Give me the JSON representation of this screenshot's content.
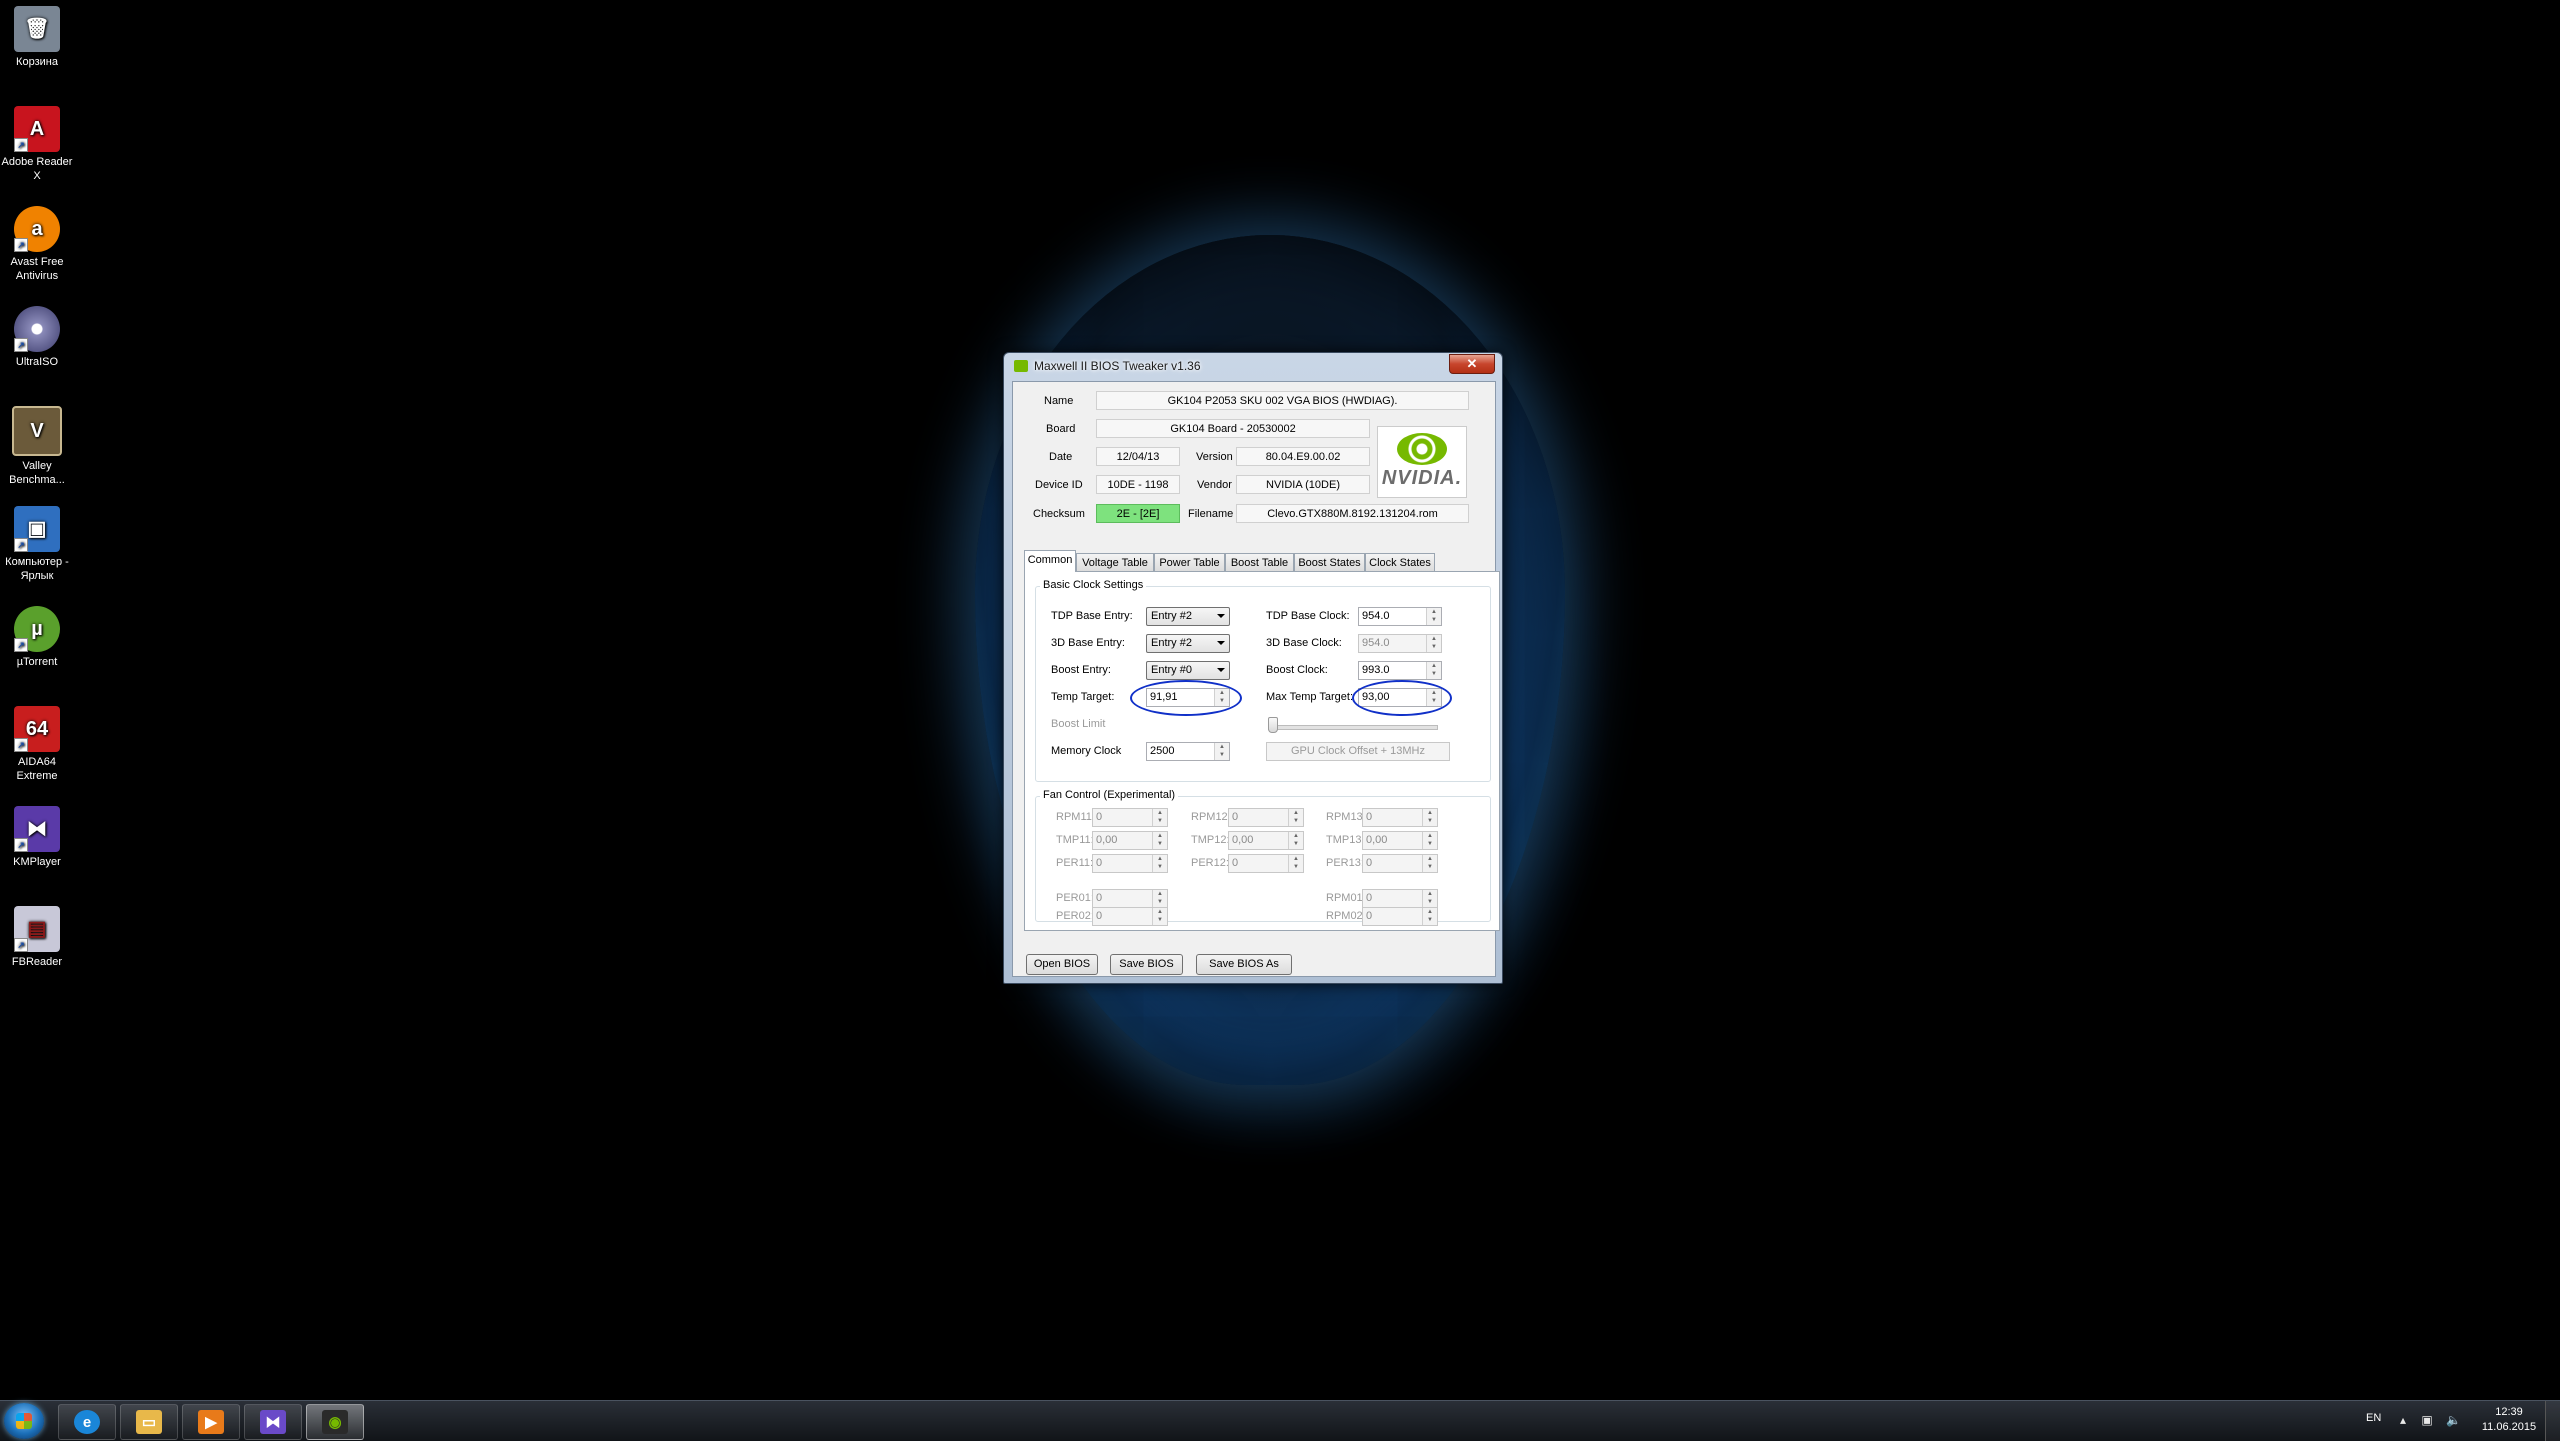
{
  "desktop": {
    "icons": [
      {
        "label": "Корзина",
        "glyph": "🗑",
        "color": "#9aa6b2"
      },
      {
        "label": "Adobe Reader X",
        "glyph": "A",
        "color": "#c8141e"
      },
      {
        "label": "Avast Free Antivirus",
        "glyph": "a",
        "color": "#f08200"
      },
      {
        "label": "UltraISO",
        "glyph": "◉",
        "color": "#6a6a9a"
      },
      {
        "label": "Valley Benchma...",
        "glyph": "V",
        "color": "#6b5a3a"
      },
      {
        "label": "Компьютер - Ярлык",
        "glyph": "▣",
        "color": "#2f6fbf"
      },
      {
        "label": "µTorrent",
        "glyph": "µ",
        "color": "#5aa02c"
      },
      {
        "label": "AIDA64 Extreme",
        "glyph": "64",
        "color": "#c81e1e"
      },
      {
        "label": "KMPlayer",
        "glyph": "⧓",
        "color": "#5a3aa8"
      },
      {
        "label": "FBReader",
        "glyph": "▤",
        "color": "#c8c8d8"
      }
    ]
  },
  "window": {
    "title": "Maxwell II BIOS Tweaker v1.36",
    "close_label": "✕",
    "info": {
      "name_label": "Name",
      "name_value": "GK104 P2053 SKU 002 VGA BIOS (HWDIAG).",
      "board_label": "Board",
      "board_value": "GK104 Board - 20530002",
      "date_label": "Date",
      "date_value": "12/04/13",
      "version_label": "Version",
      "version_value": "80.04.E9.00.02",
      "device_label": "Device ID",
      "device_value": "10DE - 1198",
      "vendor_label": "Vendor",
      "vendor_value": "NVIDIA (10DE)",
      "checksum_label": "Checksum",
      "checksum_value": "2E - [2E]",
      "filename_label": "Filename",
      "filename_value": "Clevo.GTX880M.8192.131204.rom",
      "logo_text": "NVIDIA."
    },
    "tabs": [
      "Common",
      "Voltage Table",
      "Power Table",
      "Boost Table",
      "Boost States",
      "Clock States"
    ],
    "basic": {
      "group_title": "Basic Clock Settings",
      "tdp_base_entry_label": "TDP Base Entry:",
      "tdp_base_entry_value": "Entry #2",
      "base3d_entry_label": "3D Base Entry:",
      "base3d_entry_value": "Entry #2",
      "boost_entry_label": "Boost Entry:",
      "boost_entry_value": "Entry #0",
      "temp_target_label": "Temp Target:",
      "temp_target_value": "91,91",
      "boost_limit_label": "Boost Limit",
      "memory_clock_label": "Memory Clock",
      "memory_clock_value": "2500",
      "tdp_base_clock_label": "TDP Base Clock:",
      "tdp_base_clock_value": "954.0",
      "base3d_clock_label": "3D Base Clock:",
      "base3d_clock_value": "954.0",
      "boost_clock_label": "Boost Clock:",
      "boost_clock_value": "993.0",
      "max_temp_label": "Max Temp Target:",
      "max_temp_value": "93,00",
      "gpu_offset_label": "GPU Clock Offset + 13MHz"
    },
    "fan": {
      "group_title": "Fan Control (Experimental)",
      "rpm11": "RPM11:",
      "rpm12": "RPM12:",
      "rpm13": "RPM13:",
      "tmp11": "TMP11:",
      "tmp12": "TMP12:",
      "tmp13": "TMP13:",
      "per11": "PER11:",
      "per12": "PER12:",
      "per13": "PER13:",
      "per01": "PER01:",
      "per02": "PER02:",
      "rpm01": "RPM01:",
      "rpm02": "RPM02:",
      "zero": "0",
      "zero_dec": "0,00"
    },
    "buttons": {
      "open": "Open BIOS",
      "save": "Save BIOS",
      "save_as": "Save BIOS As"
    }
  },
  "taskbar": {
    "lang": "EN",
    "time": "12:39",
    "date": "11.06.2015",
    "items": [
      {
        "name": "ie",
        "glyph": "e",
        "color": "#1a86d8"
      },
      {
        "name": "explorer",
        "glyph": "▭",
        "color": "#e8b84a"
      },
      {
        "name": "media-player",
        "glyph": "▶",
        "color": "#e87a1a"
      },
      {
        "name": "kmplayer",
        "glyph": "⧓",
        "color": "#6a4ac8"
      },
      {
        "name": "nvidia-tweaker",
        "glyph": "◉",
        "color": "#76b900"
      }
    ]
  }
}
